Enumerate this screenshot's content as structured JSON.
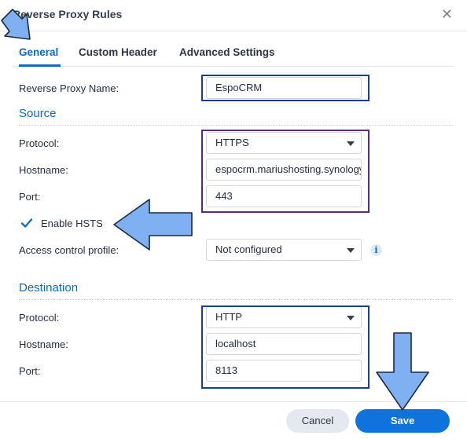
{
  "dialog": {
    "title": "Reverse Proxy Rules"
  },
  "tabs": [
    {
      "label": "General",
      "active": true
    },
    {
      "label": "Custom Header",
      "active": false
    },
    {
      "label": "Advanced Settings",
      "active": false
    }
  ],
  "form": {
    "name_label": "Reverse Proxy Name:",
    "name_value": "EspoCRM",
    "source": {
      "heading": "Source",
      "protocol_label": "Protocol:",
      "protocol_value": "HTTPS",
      "hostname_label": "Hostname:",
      "hostname_value": "espocrm.mariushosting.synology.me",
      "port_label": "Port:",
      "port_value": "443",
      "hsts_label": "Enable HSTS",
      "hsts_checked": true,
      "acl_label": "Access control profile:",
      "acl_value": "Not configured"
    },
    "destination": {
      "heading": "Destination",
      "protocol_label": "Protocol:",
      "protocol_value": "HTTP",
      "hostname_label": "Hostname:",
      "hostname_value": "localhost",
      "port_label": "Port:",
      "port_value": "8113"
    }
  },
  "footer": {
    "cancel_label": "Cancel",
    "save_label": "Save"
  },
  "colors": {
    "accent": "#0d6ac5",
    "annotation_arrow": "#7fb0f2",
    "box_blue": "#1b3f8f",
    "box_purple": "#5b2a7a"
  },
  "icons": {
    "close": "close-icon",
    "info": "info-icon",
    "dropdown": "chevron-down-icon",
    "check": "checkmark-icon"
  }
}
